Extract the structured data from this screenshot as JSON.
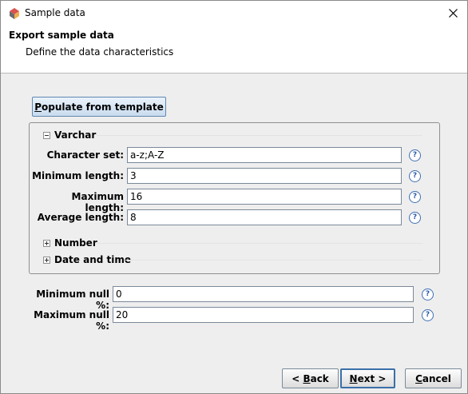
{
  "window": {
    "title": "Sample data"
  },
  "header": {
    "title": "Export sample data",
    "subtitle": "Define the data characteristics"
  },
  "populate_button": {
    "label_mnemonic": "P",
    "label_rest": "opulate from template"
  },
  "varchar": {
    "label": "Varchar",
    "expanded": true,
    "fields": [
      {
        "label": "Character set:",
        "value": "a-z;A-Z"
      },
      {
        "label": "Minimum length:",
        "value": "3"
      },
      {
        "label": "Maximum length:",
        "value": "16"
      },
      {
        "label": "Average length:",
        "value": "8"
      }
    ]
  },
  "number": {
    "label": "Number",
    "expanded": false
  },
  "date_time": {
    "label": "Date and time",
    "expanded": false
  },
  "nulls": [
    {
      "label": "Minimum null %:",
      "value": "0"
    },
    {
      "label": "Maximum null %:",
      "value": "20"
    }
  ],
  "footer": {
    "back": {
      "prefix": "< ",
      "mnemonic": "B",
      "rest": "ack"
    },
    "next": {
      "mnemonic": "N",
      "rest": "ext >"
    },
    "cancel": {
      "mnemonic": "C",
      "rest": "ancel"
    }
  },
  "help_glyph": "?",
  "colors": {
    "dialog_bg": "#eeeeee",
    "header_bg": "#ffffff",
    "accent": "#3b6fa8"
  }
}
